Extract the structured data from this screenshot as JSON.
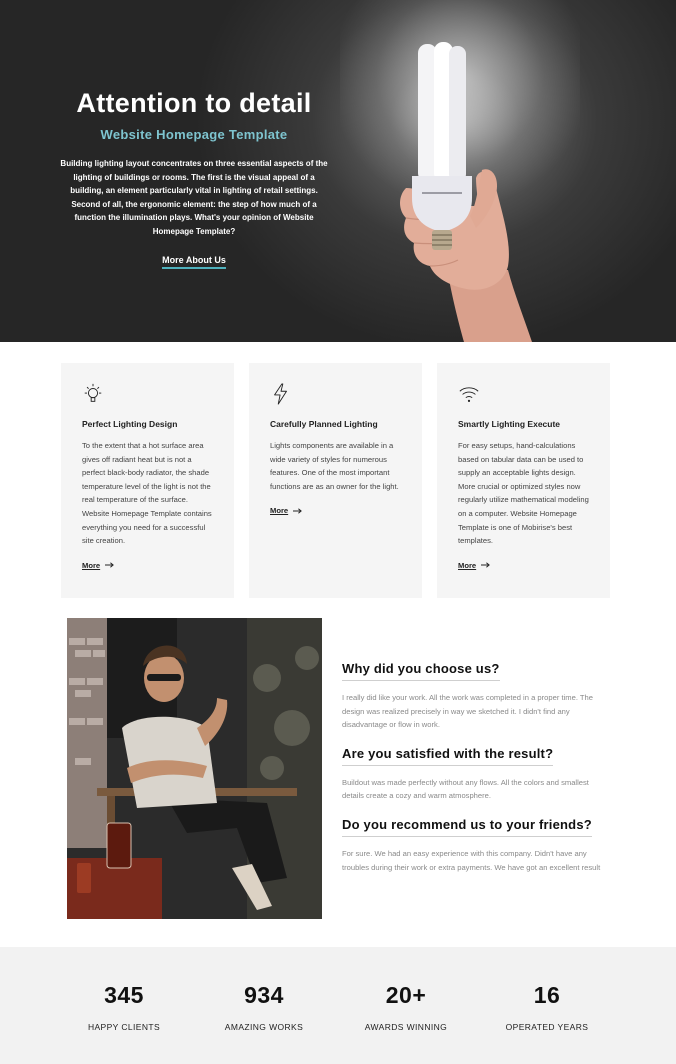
{
  "hero": {
    "title": "Attention to detail",
    "subtitle": "Website Homepage Template",
    "body": "Building lighting layout concentrates on three essential aspects of the lighting of buildings or rooms. The first is the visual appeal of a building, an element particularly vital in lighting of retail settings. Second of all, the ergonomic element: the step of how much of a function the illumination plays. What's your opinion of Website Homepage Template?",
    "link": "More About Us",
    "accent_color": "#7ec4cf",
    "underline_color": "#4fb1bd"
  },
  "features": [
    {
      "icon": "lightbulb-icon",
      "title": "Perfect Lighting Design",
      "text": "To the extent that a hot surface area gives off radiant heat but is not a perfect black-body radiator, the shade temperature level of the light is not the real temperature of the surface. Website Homepage Template contains everything you need for a successful site creation.",
      "more": "More"
    },
    {
      "icon": "lightning-bolt-icon",
      "title": "Carefully Planned Lighting",
      "text": "Lights components are available in a wide variety of styles for numerous features. One of the most important functions are as an owner for the light.",
      "more": "More"
    },
    {
      "icon": "wifi-icon",
      "title": "Smartly Lighting Execute",
      "text": "For easy setups, hand-calculations based on tabular data can be used to supply an acceptable lights design. More crucial or optimized styles now regularly utilize mathematical modeling on a computer. Website Homepage Template is one of Mobirise's best templates.",
      "more": "More"
    }
  ],
  "faq": [
    {
      "question": "Why did you choose us?",
      "answer": "I really did like your work. All the work was completed in a proper time. The design was realized precisely in way we sketched it. I didn't find any disadvantage or flow in work."
    },
    {
      "question": "Are you satisfied with the result?",
      "answer": "Buildout was made perfectly without any flows. All the colors and smallest details create a cozy and warm atmosphere."
    },
    {
      "question": "Do you recommend us to your friends?",
      "answer": "For sure. We had an easy experience with this company. Didn't have any troubles during their work or extra payments. We have got an excellent result"
    }
  ],
  "stats": [
    {
      "value": "345",
      "label": "HAPPY CLIENTS"
    },
    {
      "value": "934",
      "label": "AMAZING WORKS"
    },
    {
      "value": "20+",
      "label": "AWARDS WINNING"
    },
    {
      "value": "16",
      "label": "OPERATED YEARS"
    }
  ]
}
